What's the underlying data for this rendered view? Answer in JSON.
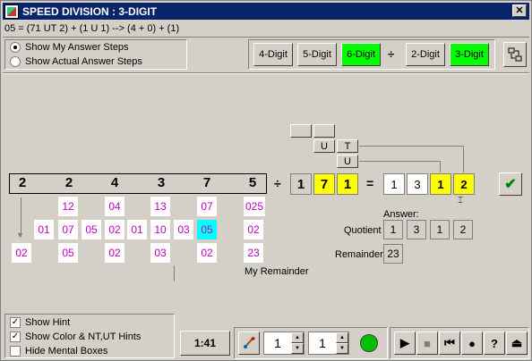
{
  "window": {
    "title": "SPEED DIVISION : 3-DIGIT"
  },
  "equation": "05 = (71 UT 2) + (1 U 1) --> (4 + 0) + (1)",
  "options": {
    "show_my_steps": "Show My Answer Steps",
    "show_actual_steps": "Show Actual Answer Steps",
    "selected": "show_my_steps"
  },
  "dividend_buttons": {
    "d4": "4-Digit",
    "d5": "5-Digit",
    "d6": "6-Digit",
    "selected": "6-Digit"
  },
  "divide_symbol": "÷",
  "divisor_buttons": {
    "d2": "2-Digit",
    "d3": "3-Digit",
    "selected": "3-Digit"
  },
  "dividend": [
    "2",
    "2",
    "4",
    "3",
    "7",
    "5"
  ],
  "work_rows": {
    "row1": [
      "12",
      "04",
      "13",
      "07",
      "025"
    ],
    "row2": [
      "01",
      "07",
      "05",
      "02",
      "01",
      "10",
      "03",
      "05",
      "02"
    ],
    "row3": [
      "02",
      "05",
      "02",
      "03",
      "02",
      "23"
    ]
  },
  "divisor": [
    "1",
    "7",
    "1"
  ],
  "equals": "=",
  "result": [
    "1",
    "3",
    "1",
    "2"
  ],
  "ut_labels": {
    "u": "U",
    "t": "T",
    "u2": "U"
  },
  "answer_label": "Answer:",
  "quotient_label": "Quotient",
  "quotient": [
    "1",
    "3",
    "1",
    "2"
  ],
  "remainder_label": "Remainder",
  "remainder": "23",
  "my_remainder_label": "My Remainder",
  "hints": {
    "show_hint": "Show Hint",
    "show_color": "Show Color & NT,UT Hints",
    "hide_mental": "Hide Mental Boxes",
    "show_hint_checked": true,
    "show_color_checked": true,
    "hide_mental_checked": false
  },
  "timer": "1:41",
  "spinner1": "1",
  "spinner2": "1",
  "status_color": "#00c000",
  "playback": [
    "play",
    "stop",
    "rewind",
    "record",
    "help",
    "eject"
  ],
  "colors": {
    "green": "#00ff00",
    "yellow": "#ffff00",
    "cyan": "#00ffff",
    "magenta": "#c000c0"
  }
}
